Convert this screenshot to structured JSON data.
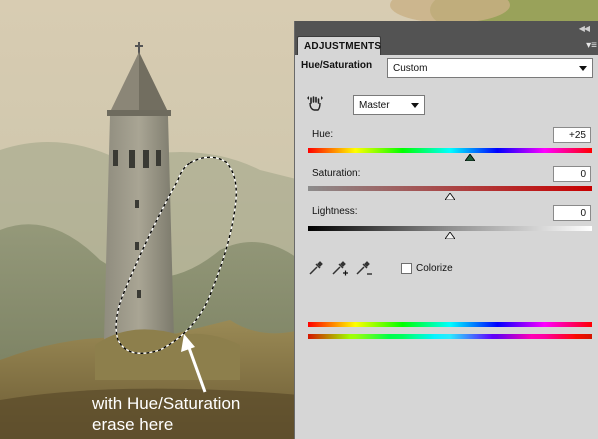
{
  "panel": {
    "tab_label": "ADJUSTMENTS",
    "title": "Hue/Saturation",
    "preset": "Custom",
    "channel": "Master",
    "hue": {
      "label": "Hue:",
      "value": "+25",
      "level": 0.57
    },
    "saturation": {
      "label": "Saturation:",
      "value": "0",
      "level": 0.5
    },
    "lightness": {
      "label": "Lightness:",
      "value": "0",
      "level": 0.5
    },
    "colorize": {
      "label": "Colorize",
      "checked": false
    },
    "icons": [
      "targeted-adjustment-hand-icon",
      "eyedropper-icon",
      "eyedropper-plus-icon",
      "eyedropper-minus-icon",
      "panel-collapse-icon",
      "panel-menu-icon"
    ]
  },
  "annotation": {
    "line1": "with Hue/Saturation",
    "line2": "erase here"
  },
  "colors": {
    "panel_bg": "#d6d6d6",
    "tabbar_bg": "#535353",
    "annotation_text": "#ffffff",
    "selection_outline": "#000000"
  }
}
